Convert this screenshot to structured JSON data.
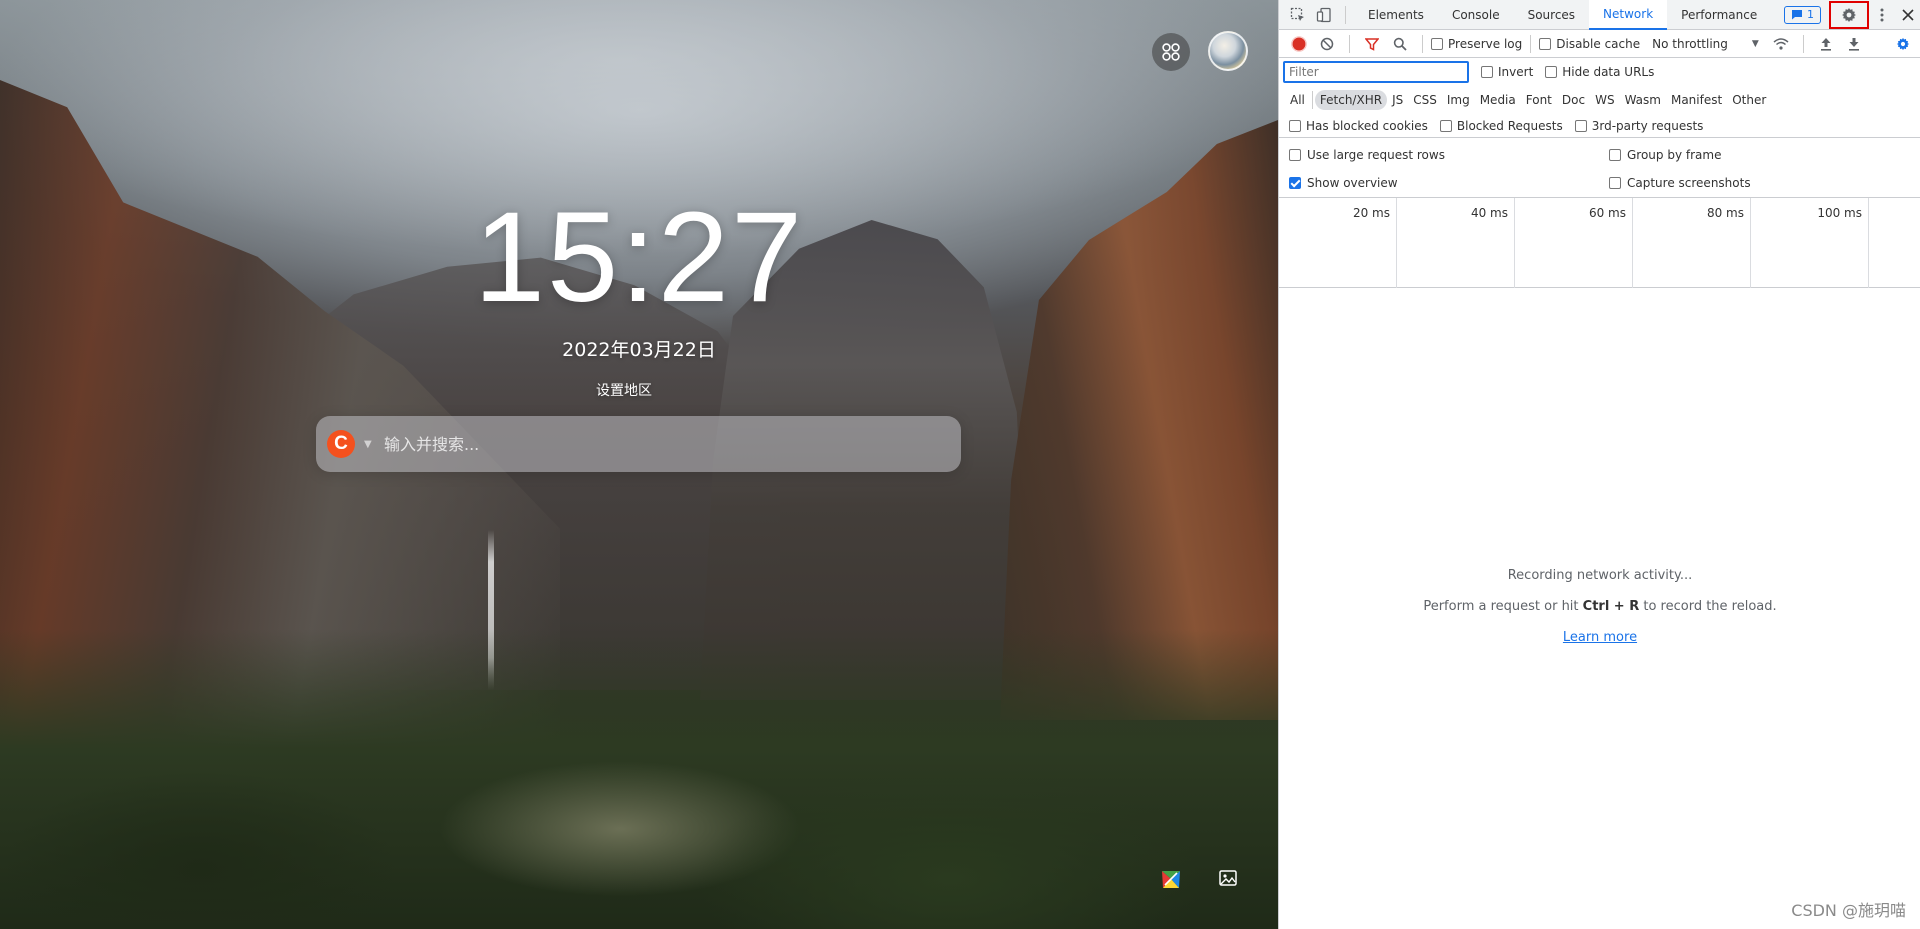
{
  "newtab": {
    "time": "15:27",
    "date": "2022年03月22日",
    "region_link": "设置地区",
    "search_placeholder": "输入并搜索...",
    "engine_letter": "C"
  },
  "devtools": {
    "tabs": [
      {
        "label": "Elements",
        "active": false
      },
      {
        "label": "Console",
        "active": false
      },
      {
        "label": "Sources",
        "active": false
      },
      {
        "label": "Network",
        "active": true
      },
      {
        "label": "Performance",
        "active": false
      }
    ],
    "messages_count": "1",
    "toolbar": {
      "preserve_log": "Preserve log",
      "disable_cache": "Disable cache",
      "throttling": "No throttling"
    },
    "filter": {
      "placeholder": "Filter",
      "invert": "Invert",
      "hide_data_urls": "Hide data URLs"
    },
    "types": [
      {
        "label": "All",
        "active": false
      },
      {
        "label": "Fetch/XHR",
        "active": true
      },
      {
        "label": "JS",
        "active": false
      },
      {
        "label": "CSS",
        "active": false
      },
      {
        "label": "Img",
        "active": false
      },
      {
        "label": "Media",
        "active": false
      },
      {
        "label": "Font",
        "active": false
      },
      {
        "label": "Doc",
        "active": false
      },
      {
        "label": "WS",
        "active": false
      },
      {
        "label": "Wasm",
        "active": false
      },
      {
        "label": "Manifest",
        "active": false
      },
      {
        "label": "Other",
        "active": false
      }
    ],
    "blocked": {
      "has_blocked_cookies": "Has blocked cookies",
      "blocked_requests": "Blocked Requests",
      "third_party": "3rd-party requests"
    },
    "settings": {
      "large_rows": "Use large request rows",
      "group_by_frame": "Group by frame",
      "show_overview": "Show overview",
      "capture_screenshots": "Capture screenshots",
      "show_overview_checked": true
    },
    "overview_ticks": [
      "20 ms",
      "40 ms",
      "60 ms",
      "80 ms",
      "100 ms"
    ],
    "empty": {
      "line1": "Recording network activity...",
      "line2_prefix": "Perform a request or hit ",
      "line2_keys": "Ctrl + R",
      "line2_suffix": " to record the reload.",
      "learn_more": "Learn more"
    },
    "colors": {
      "accent": "#1a73e8",
      "record": "#d93025",
      "highlight_box": "#e00000"
    }
  },
  "watermark": "CSDN @施玥喵"
}
